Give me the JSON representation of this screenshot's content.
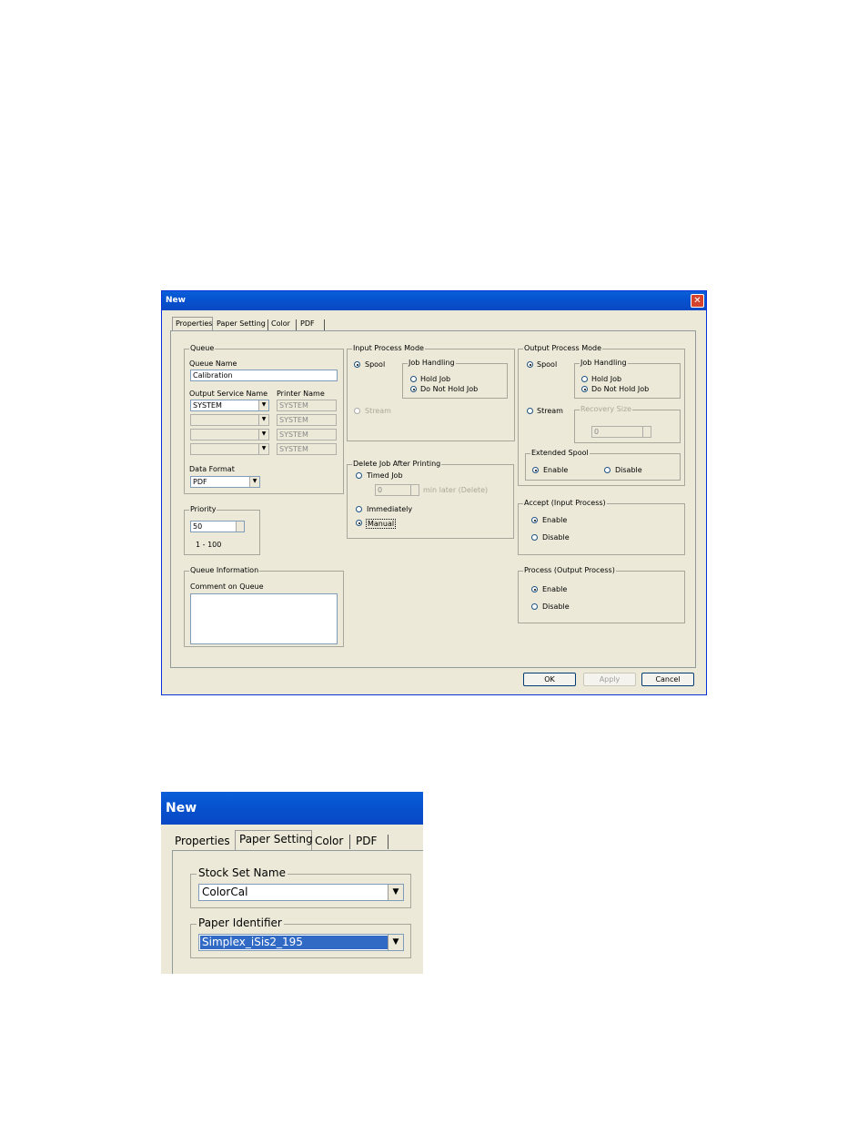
{
  "dialog1": {
    "title": "New",
    "tabs": [
      "Properties",
      "Paper Setting",
      "Color",
      "PDF"
    ],
    "queue": {
      "group_label": "Queue",
      "queue_name_label": "Queue Name",
      "queue_name_value": "Calibration",
      "output_service_label": "Output Service Name",
      "printer_name_label": "Printer Name",
      "output_service_value": "SYSTEM",
      "printer_names": [
        "SYSTEM",
        "SYSTEM",
        "SYSTEM",
        "SYSTEM"
      ],
      "data_format_label": "Data Format",
      "data_format_value": "PDF"
    },
    "priority": {
      "group_label": "Priority",
      "value": "50",
      "range": "1 - 100"
    },
    "queue_info": {
      "group_label": "Queue Information",
      "comment_label": "Comment on Queue",
      "comment_value": ""
    },
    "input_mode": {
      "group_label": "Input Process Mode",
      "spool_label": "Spool",
      "stream_label": "Stream",
      "job_handling_label": "Job Handling",
      "hold_job": "Hold Job",
      "do_not_hold_job": "Do Not Hold Job"
    },
    "delete_job": {
      "group_label": "Delete Job After Printing",
      "timed_job": "Timed Job",
      "minutes_value": "0",
      "min_later": "min later (Delete)",
      "immediately": "Immediately",
      "manual": "Manual"
    },
    "output_mode": {
      "group_label": "Output Process Mode",
      "spool_label": "Spool",
      "stream_label": "Stream",
      "job_handling_label": "Job Handling",
      "hold_job": "Hold Job",
      "do_not_hold_job": "Do Not Hold Job",
      "recovery_size_label": "Recovery Size",
      "recovery_value": "0",
      "extended_spool_label": "Extended Spool",
      "enable": "Enable",
      "disable": "Disable"
    },
    "accept_input": {
      "group_label": "Accept (Input Process)",
      "enable": "Enable",
      "disable": "Disable"
    },
    "process_output": {
      "group_label": "Process (Output Process)",
      "enable": "Enable",
      "disable": "Disable"
    },
    "buttons": {
      "ok": "OK",
      "apply": "Apply",
      "cancel": "Cancel"
    }
  },
  "dialog2": {
    "title": "New",
    "tabs": [
      "Properties",
      "Paper Setting",
      "Color",
      "PDF"
    ],
    "stock_set_label": "Stock Set Name",
    "stock_set_value": "ColorCal",
    "paper_identifier_label": "Paper Identifier",
    "paper_identifier_value": "Simplex_iSis2_195"
  }
}
